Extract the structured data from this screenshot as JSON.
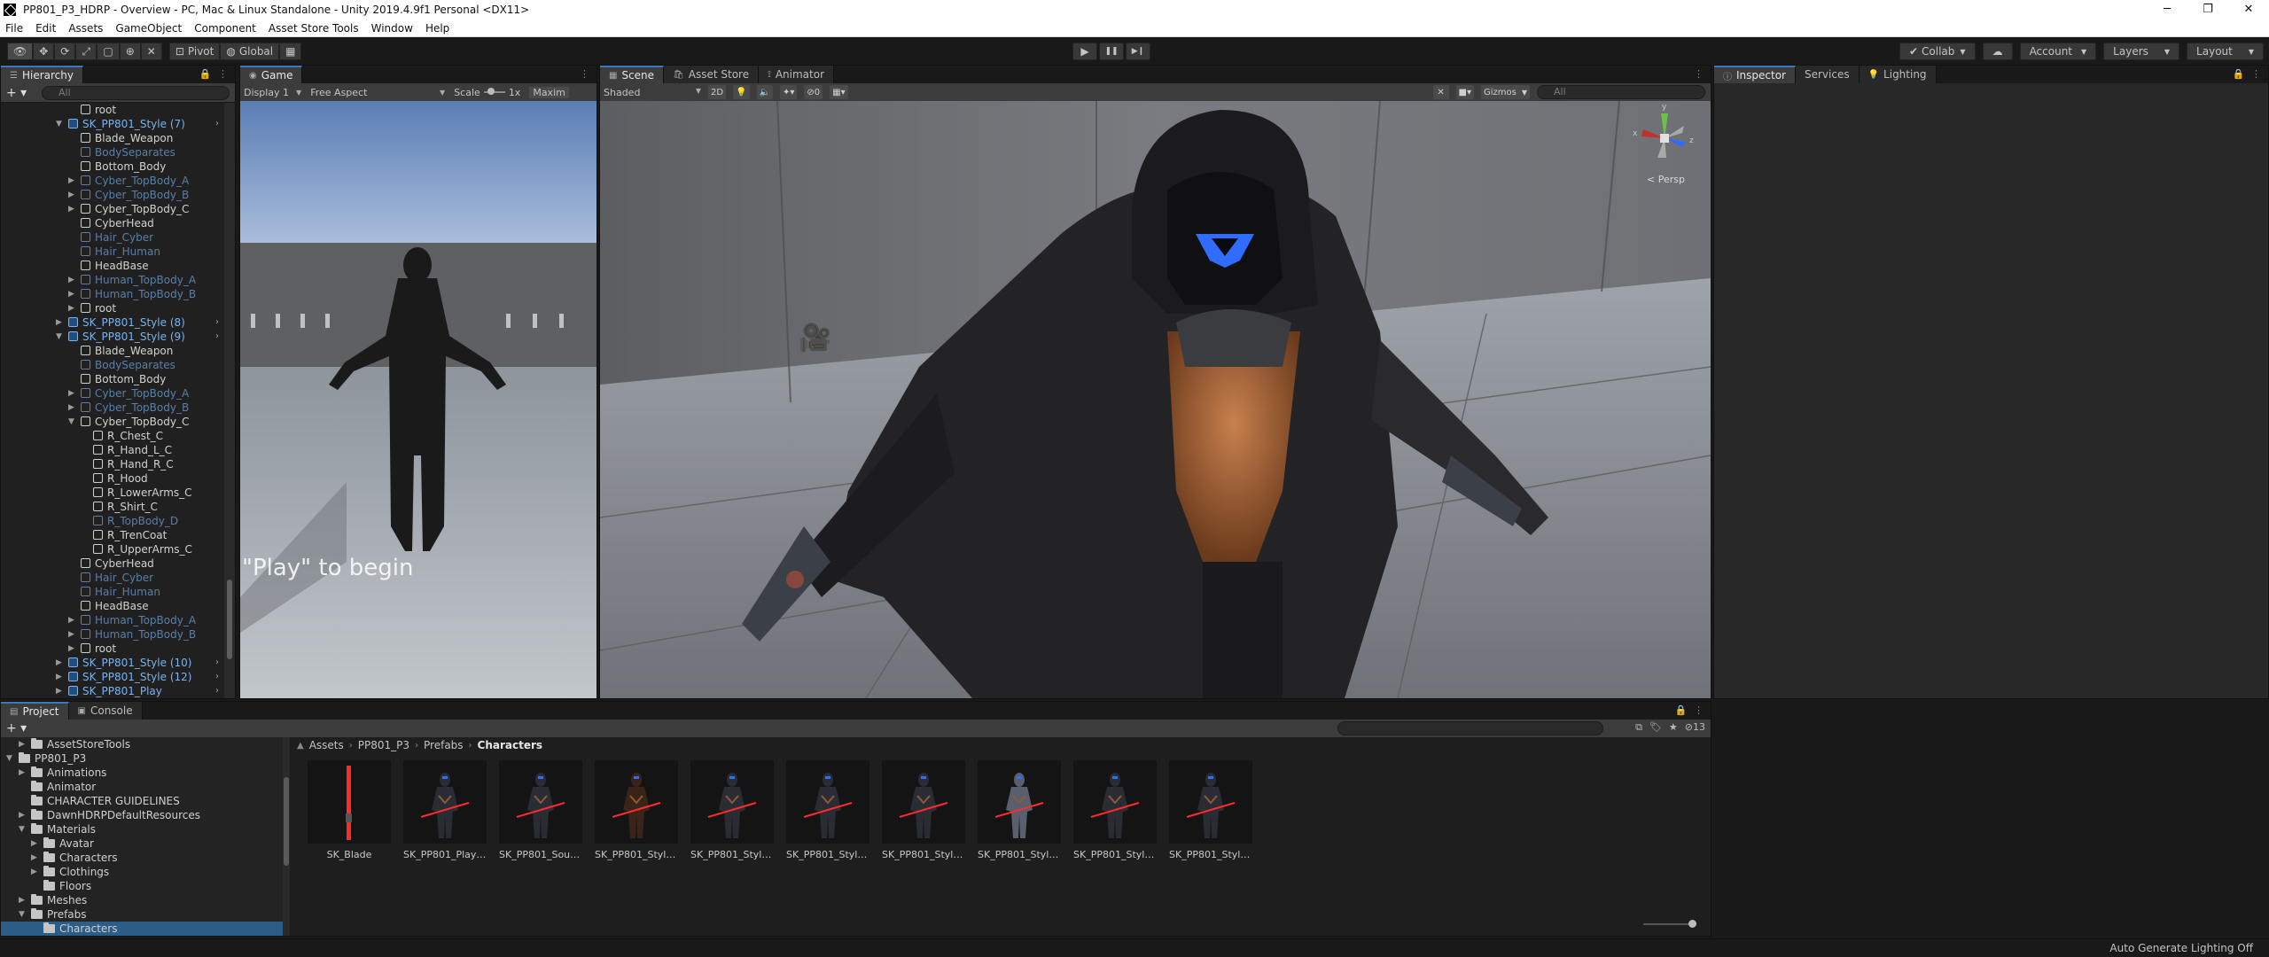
{
  "window": {
    "title": "PP801_P3_HDRP - Overview - PC, Mac & Linux Standalone - Unity 2019.4.9f1 Personal <DX11>",
    "minimize": "─",
    "maximize": "❐",
    "close": "✕"
  },
  "menu": [
    "File",
    "Edit",
    "Assets",
    "GameObject",
    "Component",
    "Asset Store Tools",
    "Window",
    "Help"
  ],
  "toolbar": {
    "pivot": "Pivot",
    "global": "Global",
    "play": "▶",
    "pause": "❚❚",
    "step": "▶❙",
    "collab": "Collab",
    "account": "Account",
    "layers": "Layers",
    "layout": "Layout"
  },
  "hierarchy": {
    "tab": "Hierarchy",
    "search_placeholder": "All",
    "items": [
      {
        "label": "root",
        "indent": 6,
        "type": "normal",
        "arrow": ""
      },
      {
        "label": "SK_PP801_Style (7)",
        "indent": 5,
        "type": "prefab",
        "arrow": "▼",
        "chev": true
      },
      {
        "label": "Blade_Weapon",
        "indent": 6,
        "type": "normal",
        "arrow": ""
      },
      {
        "label": "BodySeparates",
        "indent": 6,
        "type": "inactive",
        "arrow": ""
      },
      {
        "label": "Bottom_Body",
        "indent": 6,
        "type": "normal",
        "arrow": ""
      },
      {
        "label": "Cyber_TopBody_A",
        "indent": 6,
        "type": "inactive",
        "arrow": "▶"
      },
      {
        "label": "Cyber_TopBody_B",
        "indent": 6,
        "type": "inactive",
        "arrow": "▶"
      },
      {
        "label": "Cyber_TopBody_C",
        "indent": 6,
        "type": "normal",
        "arrow": "▶"
      },
      {
        "label": "CyberHead",
        "indent": 6,
        "type": "normal",
        "arrow": ""
      },
      {
        "label": "Hair_Cyber",
        "indent": 6,
        "type": "inactive",
        "arrow": ""
      },
      {
        "label": "Hair_Human",
        "indent": 6,
        "type": "inactive",
        "arrow": ""
      },
      {
        "label": "HeadBase",
        "indent": 6,
        "type": "normal",
        "arrow": ""
      },
      {
        "label": "Human_TopBody_A",
        "indent": 6,
        "type": "inactive",
        "arrow": "▶"
      },
      {
        "label": "Human_TopBody_B",
        "indent": 6,
        "type": "inactive",
        "arrow": "▶"
      },
      {
        "label": "root",
        "indent": 6,
        "type": "normal",
        "arrow": "▶"
      },
      {
        "label": "SK_PP801_Style (8)",
        "indent": 5,
        "type": "prefab",
        "arrow": "▶",
        "chev": true
      },
      {
        "label": "SK_PP801_Style (9)",
        "indent": 5,
        "type": "prefab",
        "arrow": "▼",
        "chev": true
      },
      {
        "label": "Blade_Weapon",
        "indent": 6,
        "type": "normal",
        "arrow": ""
      },
      {
        "label": "BodySeparates",
        "indent": 6,
        "type": "inactive",
        "arrow": ""
      },
      {
        "label": "Bottom_Body",
        "indent": 6,
        "type": "normal",
        "arrow": ""
      },
      {
        "label": "Cyber_TopBody_A",
        "indent": 6,
        "type": "inactive",
        "arrow": "▶"
      },
      {
        "label": "Cyber_TopBody_B",
        "indent": 6,
        "type": "inactive",
        "arrow": "▶"
      },
      {
        "label": "Cyber_TopBody_C",
        "indent": 6,
        "type": "normal",
        "arrow": "▼"
      },
      {
        "label": "R_Chest_C",
        "indent": 7,
        "type": "normal",
        "arrow": ""
      },
      {
        "label": "R_Hand_L_C",
        "indent": 7,
        "type": "normal",
        "arrow": ""
      },
      {
        "label": "R_Hand_R_C",
        "indent": 7,
        "type": "normal",
        "arrow": ""
      },
      {
        "label": "R_Hood",
        "indent": 7,
        "type": "normal",
        "arrow": ""
      },
      {
        "label": "R_LowerArms_C",
        "indent": 7,
        "type": "normal",
        "arrow": ""
      },
      {
        "label": "R_Shirt_C",
        "indent": 7,
        "type": "normal",
        "arrow": ""
      },
      {
        "label": "R_TopBody_D",
        "indent": 7,
        "type": "inactive",
        "arrow": ""
      },
      {
        "label": "R_TrenCoat",
        "indent": 7,
        "type": "normal",
        "arrow": ""
      },
      {
        "label": "R_UpperArms_C",
        "indent": 7,
        "type": "normal",
        "arrow": ""
      },
      {
        "label": "CyberHead",
        "indent": 6,
        "type": "normal",
        "arrow": ""
      },
      {
        "label": "Hair_Cyber",
        "indent": 6,
        "type": "inactive",
        "arrow": ""
      },
      {
        "label": "Hair_Human",
        "indent": 6,
        "type": "inactive",
        "arrow": ""
      },
      {
        "label": "HeadBase",
        "indent": 6,
        "type": "normal",
        "arrow": ""
      },
      {
        "label": "Human_TopBody_A",
        "indent": 6,
        "type": "inactive",
        "arrow": "▶"
      },
      {
        "label": "Human_TopBody_B",
        "indent": 6,
        "type": "inactive",
        "arrow": "▶"
      },
      {
        "label": "root",
        "indent": 6,
        "type": "normal",
        "arrow": "▶"
      },
      {
        "label": "SK_PP801_Style (10)",
        "indent": 5,
        "type": "prefab",
        "arrow": "▶",
        "chev": true
      },
      {
        "label": "SK_PP801_Style (12)",
        "indent": 5,
        "type": "prefab",
        "arrow": "▶",
        "chev": true
      },
      {
        "label": "SK_PP801_Play",
        "indent": 5,
        "type": "prefab",
        "arrow": "▶",
        "chev": true
      }
    ]
  },
  "game": {
    "tab": "Game",
    "display": "Display 1",
    "aspect": "Free Aspect",
    "scale_label": "Scale",
    "scale_value": "1x",
    "maximize": "Maxim",
    "overlay_text": "\"Play\" to begin"
  },
  "scene": {
    "tabs": [
      "Scene",
      "Asset Store",
      "Animator"
    ],
    "shading": "Shaded",
    "mode_2d": "2D",
    "fx_count": "0",
    "gizmos": "Gizmos",
    "search_placeholder": "All",
    "persp": "< Persp",
    "axis_x": "x",
    "axis_z": "z",
    "axis_y": "y"
  },
  "inspector": {
    "tabs": [
      "Inspector",
      "Services",
      "Lighting"
    ]
  },
  "project": {
    "tabs": [
      "Project",
      "Console"
    ],
    "hidden_count": "13",
    "tree": [
      {
        "label": "AssetStoreTools",
        "indent": 1,
        "arrow": "▶",
        "selected": false
      },
      {
        "label": "PP801_P3",
        "indent": 0,
        "arrow": "▼",
        "selected": false
      },
      {
        "label": "Animations",
        "indent": 1,
        "arrow": "▶",
        "selected": false
      },
      {
        "label": "Animator",
        "indent": 1,
        "arrow": "",
        "selected": false
      },
      {
        "label": "CHARACTER GUIDELINES",
        "indent": 1,
        "arrow": "",
        "selected": false
      },
      {
        "label": "DawnHDRPDefaultResources",
        "indent": 1,
        "arrow": "▶",
        "selected": false
      },
      {
        "label": "Materials",
        "indent": 1,
        "arrow": "▼",
        "selected": false
      },
      {
        "label": "Avatar",
        "indent": 2,
        "arrow": "▶",
        "selected": false
      },
      {
        "label": "Characters",
        "indent": 2,
        "arrow": "▶",
        "selected": false
      },
      {
        "label": "Clothings",
        "indent": 2,
        "arrow": "▶",
        "selected": false
      },
      {
        "label": "Floors",
        "indent": 2,
        "arrow": "",
        "selected": false
      },
      {
        "label": "Meshes",
        "indent": 1,
        "arrow": "▶",
        "selected": false
      },
      {
        "label": "Prefabs",
        "indent": 1,
        "arrow": "▼",
        "selected": false
      },
      {
        "label": "Characters",
        "indent": 2,
        "arrow": "",
        "selected": true
      }
    ],
    "breadcrumb": [
      "Assets",
      "PP801_P3",
      "Prefabs",
      "Characters"
    ],
    "assets": [
      {
        "name": "SK_Blade",
        "kind": "blade"
      },
      {
        "name": "SK_PP801_Play V...",
        "kind": "char"
      },
      {
        "name": "SK_PP801_Sourc...",
        "kind": "char"
      },
      {
        "name": "SK_PP801_Style (...",
        "kind": "char-warm"
      },
      {
        "name": "SK_PP801_Style (...",
        "kind": "char"
      },
      {
        "name": "SK_PP801_Style (...",
        "kind": "char"
      },
      {
        "name": "SK_PP801_Style (...",
        "kind": "char"
      },
      {
        "name": "SK_PP801_Style (...",
        "kind": "char-light"
      },
      {
        "name": "SK_PP801_Style (...",
        "kind": "char"
      },
      {
        "name": "SK_PP801_Style (...",
        "kind": "char"
      }
    ]
  },
  "status": {
    "text": "Auto Generate Lighting Off"
  },
  "colors": {
    "accent": "#3a79bb",
    "prefab": "#7ab3ef",
    "visor": "#2f6cff",
    "blade": "#ff2a2a"
  }
}
